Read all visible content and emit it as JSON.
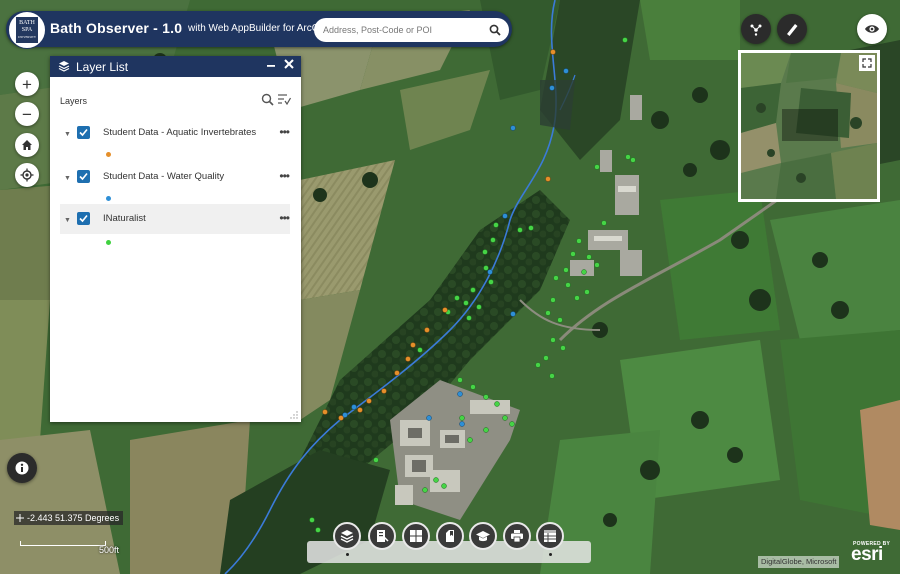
{
  "header": {
    "logo_text": [
      "BATH",
      "SPA",
      "UNIVERSITY"
    ],
    "title": "Bath Observer - 1.0",
    "subtitle": "with Web AppBuilder for ArcGIS",
    "search_placeholder": "Address, Post-Code or POI"
  },
  "map_controls": {
    "zoom_in": "+",
    "zoom_out": "−",
    "home_icon": "home-icon",
    "locate_icon": "locate-icon",
    "info_icon": "info-icon"
  },
  "top_right_icons": [
    "nearby-icon",
    "measure-icon",
    "visibility-icon"
  ],
  "layer_list": {
    "title": "Layer List",
    "section_label": "Layers",
    "layers": [
      {
        "name": "Student Data - Aquatic Invertebrates",
        "checked": true,
        "color": "#e58f2a"
      },
      {
        "name": "Student Data - Water Quality",
        "checked": true,
        "color": "#2e8fd6"
      },
      {
        "name": "INaturalist",
        "checked": true,
        "color": "#3fd13f"
      }
    ]
  },
  "toolbar": {
    "tools": [
      "layers-icon",
      "legend-icon",
      "basemap-gallery-icon",
      "bookmark-icon",
      "education-icon",
      "print-icon",
      "attribute-table-icon"
    ]
  },
  "status": {
    "coordinates": "-2.443 51.375 Degrees",
    "scale_label": "500ft",
    "attribution": "DigitalGlobe, Microsoft",
    "esri_powered": "POWERED BY",
    "esri_logo": "esri"
  },
  "colors": {
    "header": "#1f3560",
    "checkbox": "#1e6fb0",
    "aquatic": "#e58f2a",
    "water_quality": "#2e8fd6",
    "inaturalist": "#3fd13f",
    "stream": "#3b7bd8"
  }
}
